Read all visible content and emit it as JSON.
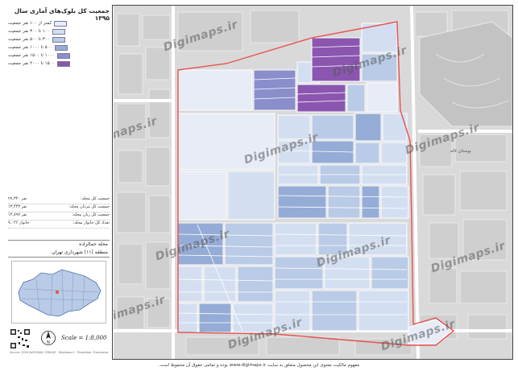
{
  "legend": {
    "title": "جمعیت کل بلوک‌های آماری سال ۱۳۹۵",
    "items": [
      {
        "label": "کمتر از ۱۰۰ نفر جمعیت",
        "color": "#e8ecf7"
      },
      {
        "label": "۱۰۰ تا ۳۰۰ نفر جمعیت",
        "color": "#d3dff1"
      },
      {
        "label": "۳۰۰ تا ۵۰۰ نفر جمعیت",
        "color": "#b9cbe6"
      },
      {
        "label": "۵۰۰ تا ۱۰۰۰ نفر جمعیت",
        "color": "#95acd6"
      },
      {
        "label": "۱۰۰۰ تا ۱۵۰۰ نفر جمعیت",
        "color": "#8a8ecb"
      },
      {
        "label": "۱۵۰۰ تا ۲۰۰۰ نفر جمعیت",
        "color": "#8a56b0"
      }
    ]
  },
  "stats": [
    {
      "label": "جمعیت کل محله:",
      "value": "۲۷,۳۴۰ نفر"
    },
    {
      "label": "جمعیت کل مردان محله:",
      "value": "۱۳,۴۴۳ نفر"
    },
    {
      "label": "جمعیت کل زنان محله:",
      "value": "۱۳,۸۹۷ نفر"
    },
    {
      "label": "تعداد کل خانوار محله:",
      "value": "۹,۰۲۶ خانوار"
    }
  ],
  "area": {
    "neighborhood": "محله جمالزاده",
    "district": "منطقه (۱۱) شهرداری تهران"
  },
  "scale": "Scale = 1:8,000",
  "credit": "Source: 2016 NATIONAL CENSUS · Digimaps.ir · Projection: Transverse Mercator",
  "watermark": "Digimaps.ir",
  "map_labels": {
    "label_1": "بوستان لاله"
  },
  "footer": "مفهوم مالکیت معنوی این محصول متعلق به سایت www.digimaps.ir بوده و تمامی حقوق آن محفوظ است.",
  "colors": {
    "boundary": "#e8524f",
    "street": "#ffffff",
    "background": "#dcdcdc"
  }
}
